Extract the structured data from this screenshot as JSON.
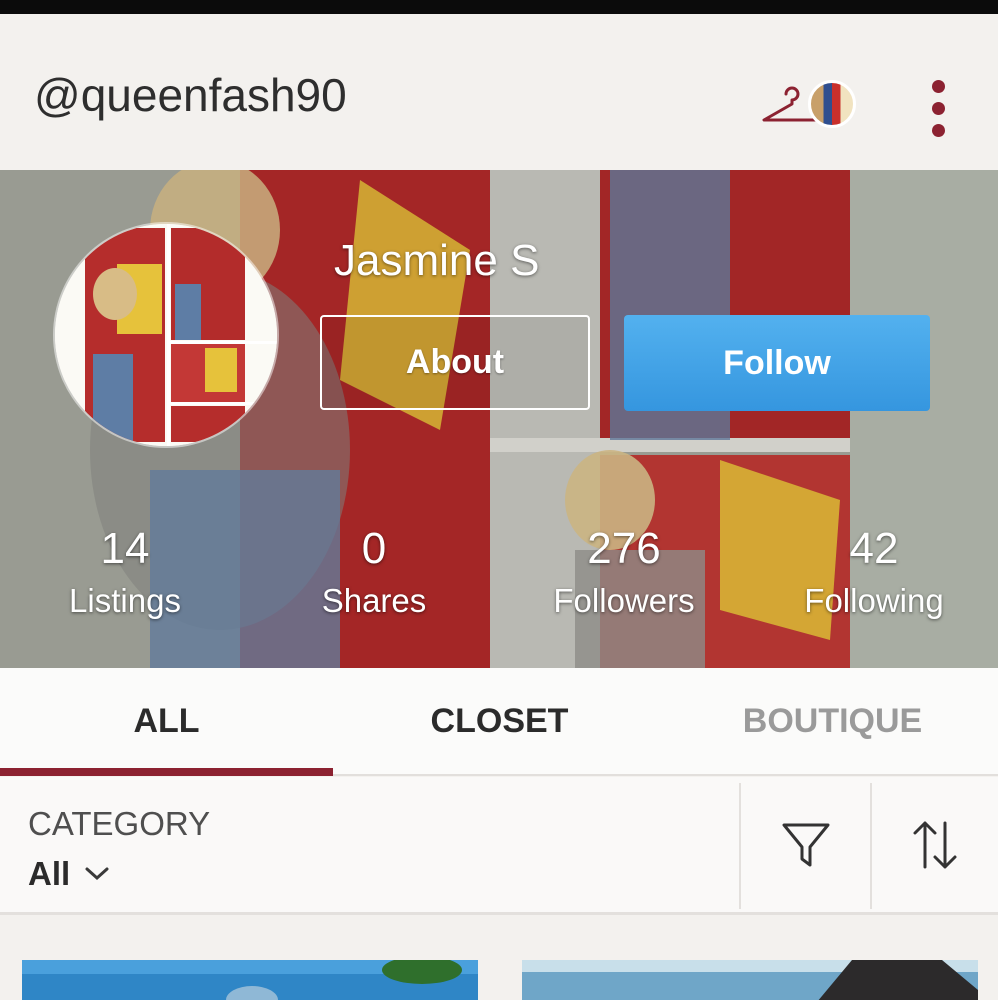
{
  "header": {
    "handle": "@queenfash90",
    "icons": {
      "closet": "hanger-icon",
      "menu": "more-vertical-icon"
    }
  },
  "profile": {
    "name": "Jasmine S",
    "about_label": "About",
    "follow_label": "Follow",
    "stats": [
      {
        "value": "14",
        "label": "Listings"
      },
      {
        "value": "0",
        "label": "Shares"
      },
      {
        "value": "276",
        "label": "Followers"
      },
      {
        "value": "42",
        "label": "Following"
      }
    ]
  },
  "tabs": [
    {
      "label": "ALL",
      "selected": true
    },
    {
      "label": "CLOSET",
      "selected": false
    },
    {
      "label": "BOUTIQUE",
      "selected": false
    }
  ],
  "filters": {
    "category_label": "CATEGORY",
    "category_value": "All",
    "icons": {
      "filter": "filter-icon",
      "sort": "sort-icon"
    }
  },
  "colors": {
    "accent": "#8c2231",
    "follow_button": "#3a9de4",
    "tab_active_text": "#2b2b2b",
    "tab_inactive_text": "#9a9a9a",
    "background": "#f4f2ef"
  }
}
